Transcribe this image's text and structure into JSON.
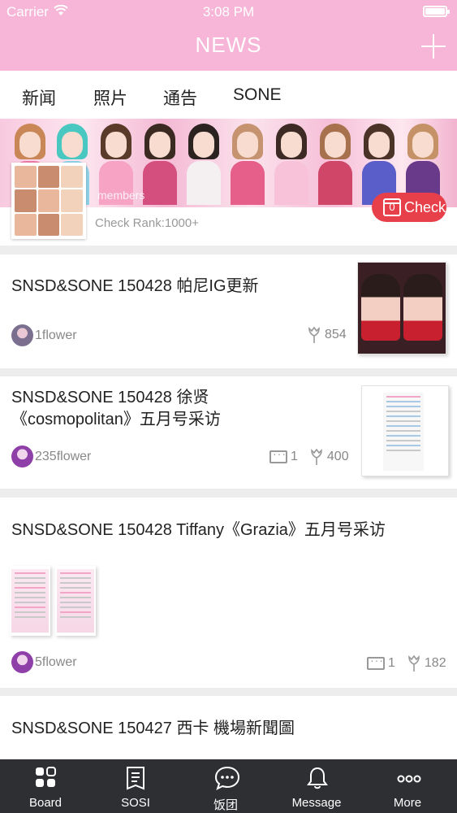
{
  "status_bar": {
    "carrier": "Carrier",
    "time": "3:08 PM"
  },
  "nav": {
    "title": "NEWS"
  },
  "tabs": [
    {
      "label": "新闻",
      "active": true
    },
    {
      "label": "照片",
      "active": false
    },
    {
      "label": "通告",
      "active": false
    },
    {
      "label": "SONE",
      "active": false
    }
  ],
  "banner": {
    "members_text": "members",
    "rank_text": "Check Rank:1000+",
    "check_label": "Check",
    "check_count": "0"
  },
  "posts": [
    {
      "title": "SNSD&SONE 150428 帕尼IG更新",
      "author": "1flower",
      "likes": "854",
      "comments": null
    },
    {
      "title": "SNSD&SONE 150428 徐贤《cosmopolitan》五月号采访",
      "author": "235flower",
      "comments": "1",
      "likes": "400"
    },
    {
      "title": "SNSD&SONE 150428 Tiffany《Grazia》五月号采访",
      "author": "5flower",
      "comments": "1",
      "likes": "182"
    },
    {
      "title": "SNSD&SONE 150427 西卡 機場新聞圖"
    }
  ],
  "tabbar": [
    {
      "label": "Board",
      "icon": "board-icon"
    },
    {
      "label": "SOSI",
      "icon": "sosi-icon"
    },
    {
      "label": "饭团",
      "icon": "chat-bubble-icon"
    },
    {
      "label": "Message",
      "icon": "bell-icon"
    },
    {
      "label": "More",
      "icon": "more-icon"
    }
  ],
  "colors": {
    "nav_pink": "#f7b6d7",
    "check_red": "#e8404a",
    "tabbar_bg": "#2d2f33"
  }
}
